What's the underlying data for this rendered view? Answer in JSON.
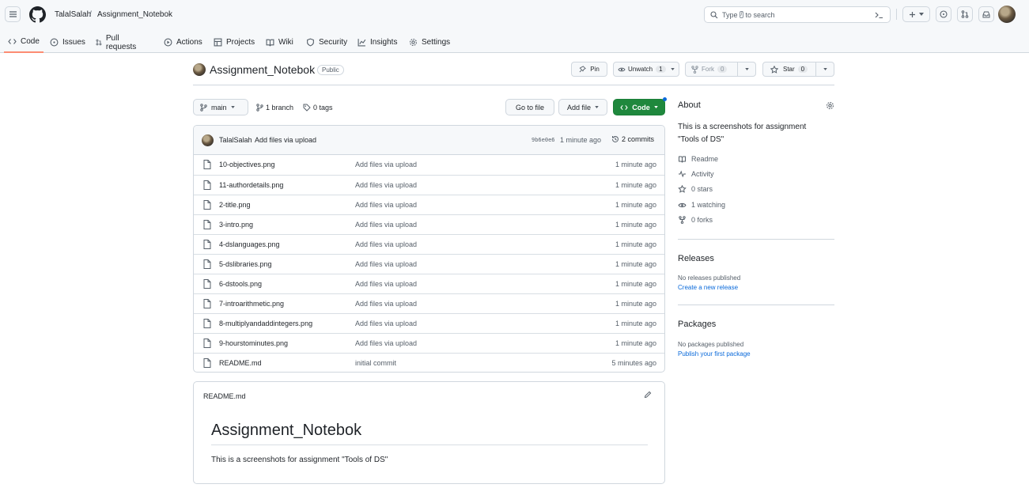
{
  "header": {
    "owner": "TalalSalah",
    "separator": "/",
    "repo": "Assignment_Notebok",
    "search": {
      "prefix": "Type",
      "key": "/",
      "suffix": "to search"
    }
  },
  "tabs": [
    {
      "label": "Code",
      "icon": "code-icon",
      "active": true
    },
    {
      "label": "Issues",
      "icon": "issue-icon"
    },
    {
      "label": "Pull requests",
      "icon": "pull-request-icon"
    },
    {
      "label": "Actions",
      "icon": "play-icon"
    },
    {
      "label": "Projects",
      "icon": "table-icon"
    },
    {
      "label": "Wiki",
      "icon": "book-icon"
    },
    {
      "label": "Security",
      "icon": "shield-icon"
    },
    {
      "label": "Insights",
      "icon": "graph-icon"
    },
    {
      "label": "Settings",
      "icon": "gear-icon"
    }
  ],
  "repo_header": {
    "title": "Assignment_Notebok",
    "visibility": "Public",
    "pin_label": "Pin",
    "unwatch_label": "Unwatch",
    "watch_count": "1",
    "fork_label": "Fork",
    "fork_count": "0",
    "star_label": "Star",
    "star_count": "0"
  },
  "toolbar": {
    "branch": "main",
    "branches": "1 branch",
    "tags": "0 tags",
    "go_to_file": "Go to file",
    "add_file": "Add file",
    "code": "Code"
  },
  "commit": {
    "author": "TalalSalah",
    "message": "Add files via upload",
    "hash": "9b6e0e6",
    "time": "1 minute ago",
    "commits": "2 commits"
  },
  "files": [
    {
      "name": "10-objectives.png",
      "message": "Add files via upload",
      "age": "1 minute ago"
    },
    {
      "name": "11-authordetails.png",
      "message": "Add files via upload",
      "age": "1 minute ago"
    },
    {
      "name": "2-title.png",
      "message": "Add files via upload",
      "age": "1 minute ago"
    },
    {
      "name": "3-intro.png",
      "message": "Add files via upload",
      "age": "1 minute ago"
    },
    {
      "name": "4-dslanguages.png",
      "message": "Add files via upload",
      "age": "1 minute ago"
    },
    {
      "name": "5-dslibraries.png",
      "message": "Add files via upload",
      "age": "1 minute ago"
    },
    {
      "name": "6-dstools.png",
      "message": "Add files via upload",
      "age": "1 minute ago"
    },
    {
      "name": "7-introarithmetic.png",
      "message": "Add files via upload",
      "age": "1 minute ago"
    },
    {
      "name": "8-multiplyandaddintegers.png",
      "message": "Add files via upload",
      "age": "1 minute ago"
    },
    {
      "name": "9-hourstominutes.png",
      "message": "Add files via upload",
      "age": "1 minute ago"
    },
    {
      "name": "README.md",
      "message": "initial commit",
      "age": "5 minutes ago"
    }
  ],
  "readme": {
    "filename": "README.md",
    "heading": "Assignment_Notebok",
    "body": "This is a screenshots for assignment \"Tools of DS\""
  },
  "about": {
    "title": "About",
    "description": "This is a screenshots for assignment \"Tools of DS\"",
    "items": [
      {
        "label": "Readme",
        "icon": "book-icon"
      },
      {
        "label": "Activity",
        "icon": "pulse-icon"
      },
      {
        "label": "0 stars",
        "icon": "star-icon"
      },
      {
        "label": "1 watching",
        "icon": "eye-icon"
      },
      {
        "label": "0 forks",
        "icon": "fork-icon"
      }
    ]
  },
  "releases": {
    "title": "Releases",
    "empty": "No releases published",
    "link": "Create a new release"
  },
  "packages": {
    "title": "Packages",
    "empty": "No packages published",
    "link": "Publish your first package"
  },
  "colors": {
    "accent_green": "#1f883d",
    "link_blue": "#0969da",
    "active_tab": "#fd8c73"
  }
}
